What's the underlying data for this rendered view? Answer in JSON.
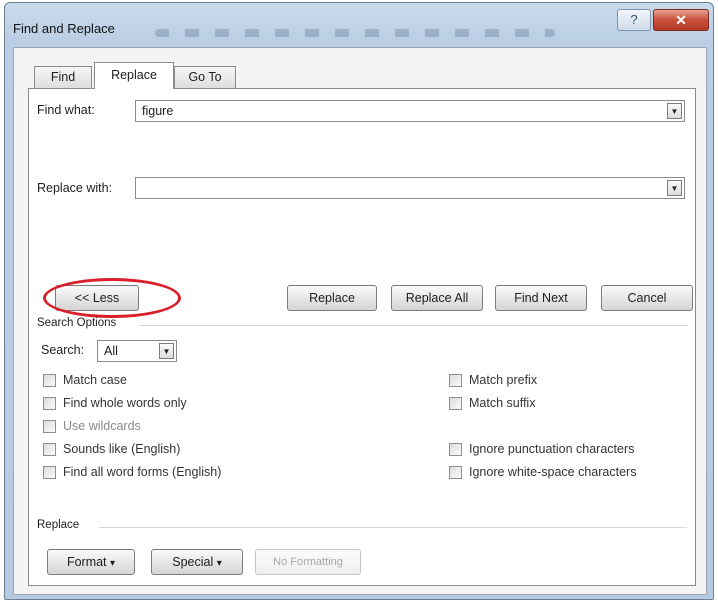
{
  "window": {
    "title": "Find and Replace",
    "help_glyph": "?",
    "close_glyph": "✕"
  },
  "tabs": [
    {
      "label": "Find",
      "active": false
    },
    {
      "label": "Replace",
      "active": true
    },
    {
      "label": "Go To",
      "active": false
    }
  ],
  "find": {
    "label": "Find what:",
    "value": "figure"
  },
  "replace": {
    "label": "Replace with:",
    "value": ""
  },
  "buttons": {
    "less": "<< Less",
    "replace": "Replace",
    "replace_all": "Replace All",
    "find_next": "Find Next",
    "cancel": "Cancel"
  },
  "search_options": {
    "heading": "Search Options",
    "search_label": "Search:",
    "search_value": "All",
    "left_options": [
      {
        "label": "Match case",
        "checked": false
      },
      {
        "label": "Find whole words only",
        "checked": false
      },
      {
        "label": "Use wildcards",
        "checked": false
      },
      {
        "label": "Sounds like (English)",
        "checked": false
      },
      {
        "label": "Find all word forms (English)",
        "checked": false
      }
    ],
    "right_options": [
      {
        "label": "Match prefix",
        "checked": false
      },
      {
        "label": "Match suffix",
        "checked": false
      },
      {
        "label": "Ignore punctuation characters",
        "checked": false
      },
      {
        "label": "Ignore white-space characters",
        "checked": false
      }
    ]
  },
  "replace_section": {
    "heading": "Replace",
    "format": "Format",
    "special": "Special",
    "no_formatting": "No Formatting",
    "dropdown_glyph": "▾"
  },
  "colors": {
    "highlight_ring": "#d9202a",
    "title_bar": "#b9cde4"
  }
}
